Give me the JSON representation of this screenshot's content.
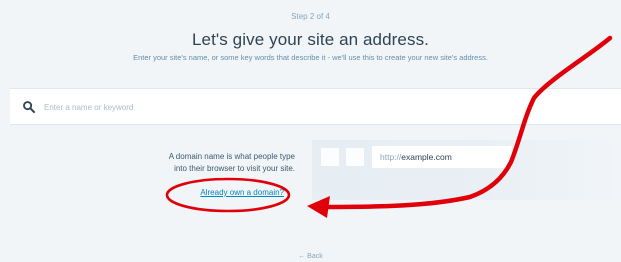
{
  "header": {
    "step": "Step 2 of 4",
    "title": "Let's give your site an address.",
    "subtitle": "Enter your site's name, or some key words that describe it - we'll use this to create your new site's address."
  },
  "search": {
    "placeholder": "Enter a name or keyword",
    "value": "",
    "icon": "search-icon"
  },
  "info": {
    "line1": "A domain name is what people type",
    "line2": "into their browser to visit your site.",
    "link": "Already own a domain?"
  },
  "browser_mock": {
    "url_prefix": "http://",
    "url_domain": "example.com"
  },
  "footer": {
    "back": "← Back"
  },
  "colors": {
    "background": "#f1f5f8",
    "title": "#2e4453",
    "link": "#0087be",
    "annotation": "#e0000a"
  }
}
